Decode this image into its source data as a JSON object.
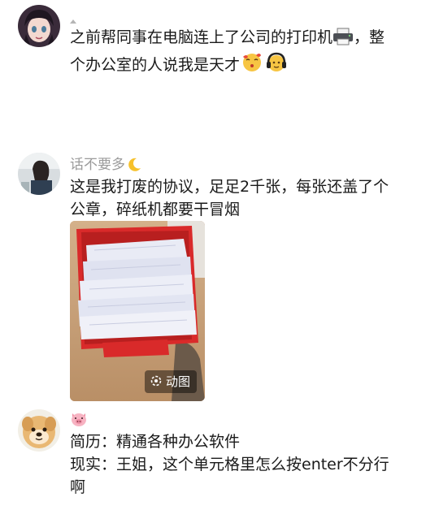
{
  "feed": {
    "posts": [
      {
        "username": "",
        "avatar": "anime-girl-avatar",
        "lines": [
          "之前帮同事在电脑连上了公司的打印机",
          "，整",
          "个办公室的人说我是天才"
        ],
        "emoji": [
          "printer-emoji",
          "kissing-face-emoji",
          "headphones-face-emoji"
        ]
      },
      {
        "username": "话不要多",
        "username_emoji": "crescent-moon-emoji",
        "avatar": "girl-photo-avatar",
        "lines": [
          "这是我打废的协议，足足2千张，每张还盖了个",
          "公章，碎纸机都要干冒烟"
        ],
        "media": {
          "description_icon": "paper-stack-photo",
          "badge_label": "动图",
          "badge_icon": "gif-icon"
        }
      },
      {
        "username": "",
        "username_emoji": "pig-face-emoji",
        "avatar": "dog-avatar",
        "lines": [
          "简历：精通各种办公软件",
          "现实：王姐，这个单元格里怎么按enter不分行",
          "啊"
        ]
      }
    ]
  },
  "colors": {
    "text": "#1a1a1a",
    "username": "#9b9b9b",
    "background": "#ffffff",
    "bag_red": "#d92a2a",
    "paper": "#e9ebf5"
  }
}
